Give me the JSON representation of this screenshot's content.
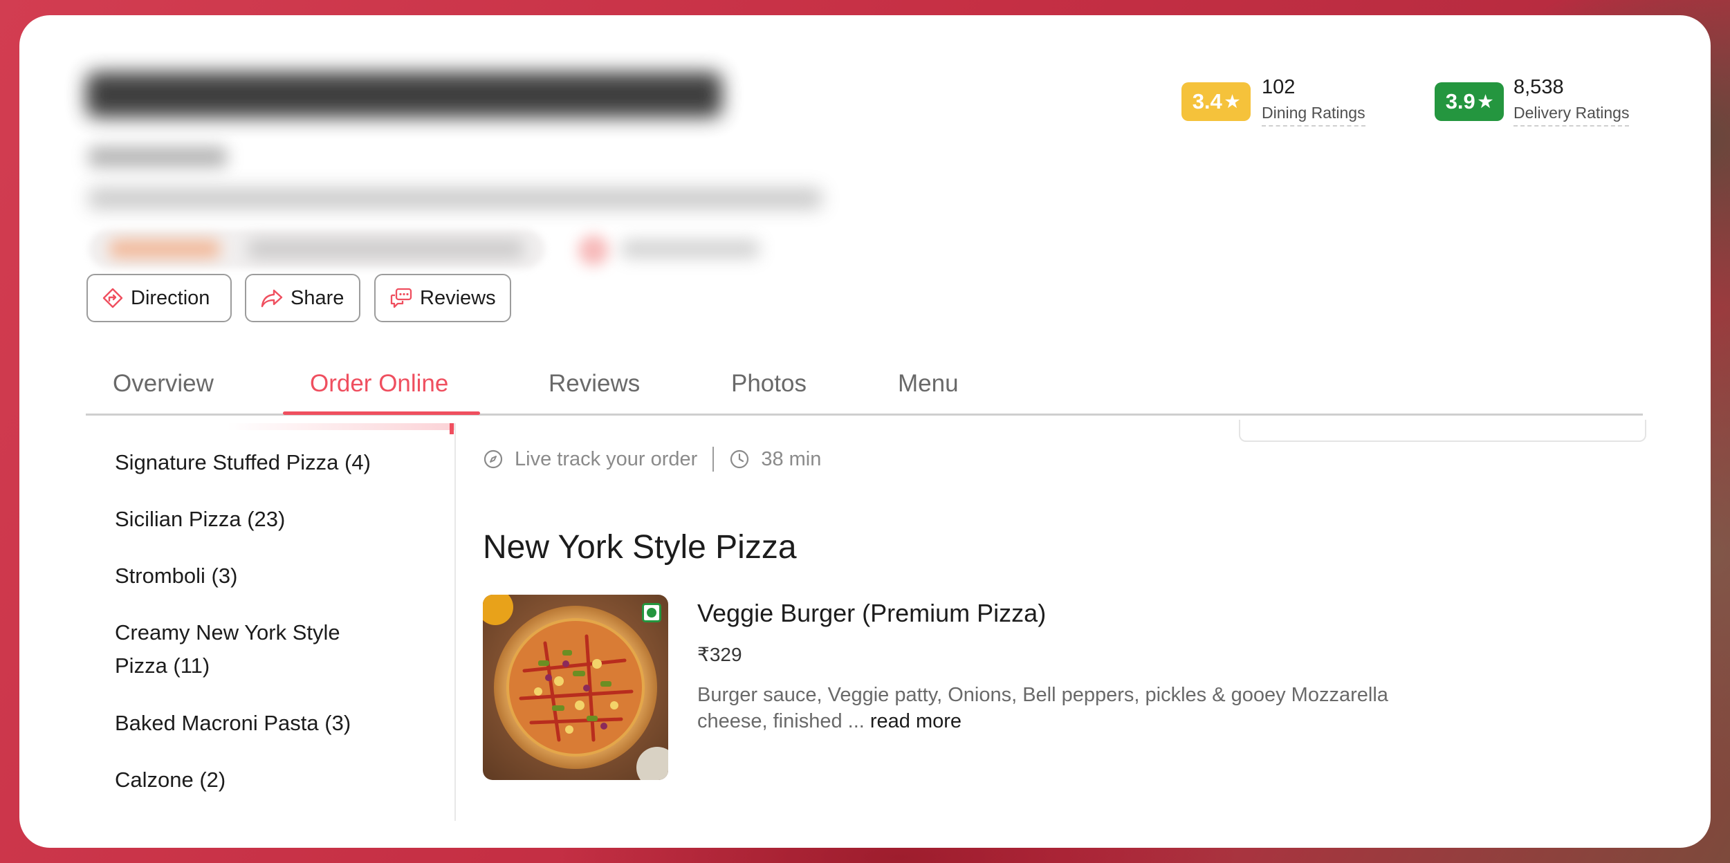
{
  "ratings": {
    "dining": {
      "score": "3.4",
      "count": "102",
      "label": "Dining Ratings",
      "color": "#f5c23b"
    },
    "delivery": {
      "score": "3.9",
      "count": "8,538",
      "label": "Delivery Ratings",
      "color": "#24963f"
    }
  },
  "actions": {
    "direction": {
      "label": "Direction",
      "icon": "direction-icon"
    },
    "share": {
      "label": "Share",
      "icon": "share-icon"
    },
    "reviews": {
      "label": "Reviews",
      "icon": "reviews-icon"
    }
  },
  "tabs": [
    {
      "label": "Overview",
      "active": false
    },
    {
      "label": "Order Online",
      "active": true
    },
    {
      "label": "Reviews",
      "active": false
    },
    {
      "label": "Photos",
      "active": false
    },
    {
      "label": "Menu",
      "active": false
    }
  ],
  "categories": [
    {
      "label": "Signature Stuffed Pizza (4)"
    },
    {
      "label": "Sicilian Pizza (23)"
    },
    {
      "label": "Stromboli (3)"
    },
    {
      "label": "Creamy New York Style Pizza (11)"
    },
    {
      "label": "Baked Macroni Pasta (3)"
    },
    {
      "label": "Calzone (2)"
    }
  ],
  "order_info": {
    "live_track": "Live track your order",
    "delivery_time": "38 min"
  },
  "section": {
    "title": "New York Style Pizza"
  },
  "dish": {
    "name": "Veggie Burger (Premium Pizza)",
    "price": "₹329",
    "description": "Burger sauce, Veggie patty, Onions, Bell peppers, pickles & gooey Mozzarella cheese, finished ...",
    "read_more": "read more",
    "veg_indicator": "veg-icon"
  },
  "colors": {
    "accent": "#ef4f5f",
    "veg": "#24963f"
  }
}
